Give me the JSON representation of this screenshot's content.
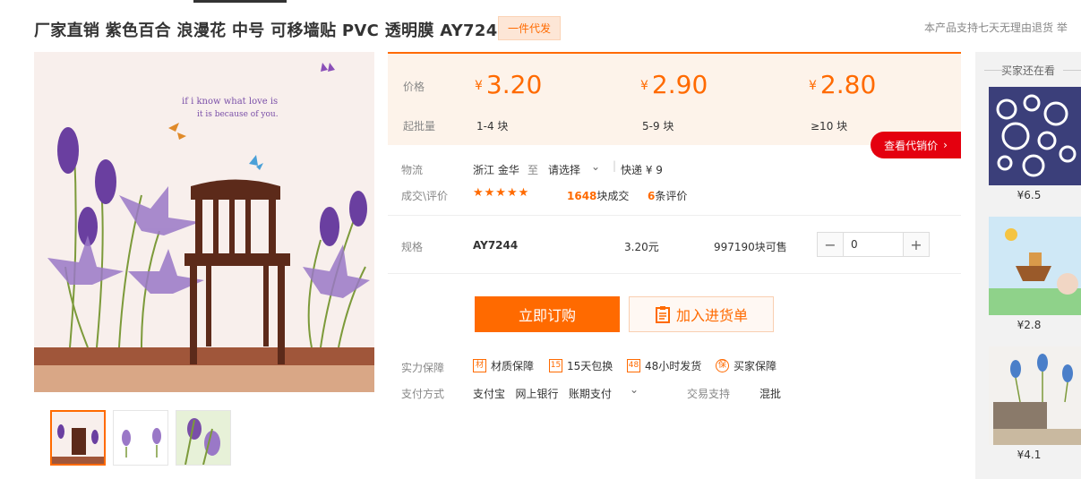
{
  "header": {
    "title": "厂家直销 紫色百合 浪漫花 中号 可移墙贴 PVC 透明膜 AY7244",
    "badge": "一件代发",
    "return_note": "本产品支持七天无理由退货   举"
  },
  "gallery": {
    "main_caption_line1": "if i know what love is",
    "main_caption_line2": "it is because of you.",
    "thumbs": [
      "thumb-1",
      "thumb-2",
      "thumb-3"
    ]
  },
  "price_panel": {
    "price_label": "价格",
    "min_qty_label": "起批量",
    "currency": "¥",
    "tiers": [
      {
        "price": "3.20",
        "range": "1-4 块"
      },
      {
        "price": "2.90",
        "range": "5-9 块"
      },
      {
        "price": "2.80",
        "range": "≥10 块"
      }
    ],
    "quote_button": "查看代销价"
  },
  "logistics": {
    "label": "物流",
    "origin": "浙江 金华",
    "to": "至",
    "destination": "请选择",
    "express": "快递 ¥ 9"
  },
  "sales": {
    "label": "成交\\评价",
    "stars": "★★★★★",
    "deals_count": "1648",
    "deals_unit": "块成交",
    "reviews_count": "6",
    "reviews_unit": "条评价"
  },
  "spec": {
    "label": "规格",
    "model": "AY7244",
    "unit_price": "3.20元",
    "stock": "997190块可售",
    "quantity": "0",
    "minus": "−",
    "plus": "+"
  },
  "actions": {
    "buy": "立即订购",
    "cart": "加入进货单"
  },
  "guarantees": {
    "label": "实力保障",
    "items": [
      {
        "icon": "材",
        "text": "材质保障"
      },
      {
        "icon": "15",
        "text": "15天包换"
      },
      {
        "icon": "48",
        "text": "48小时发货"
      },
      {
        "icon": "保",
        "text": "买家保障"
      }
    ]
  },
  "payment": {
    "label": "支付方式",
    "methods": "支付宝   网上银行   账期支付",
    "trade_label": "交易支持",
    "trade_value": "混批"
  },
  "sidebar": {
    "title": "买家还在看",
    "items": [
      {
        "price": "¥6.5"
      },
      {
        "price": "¥2.8"
      },
      {
        "price": "¥4.1"
      }
    ]
  },
  "colors": {
    "accent": "#ff6a00",
    "quote_red": "#e4000f",
    "price_bg": "#fdf3ea"
  }
}
